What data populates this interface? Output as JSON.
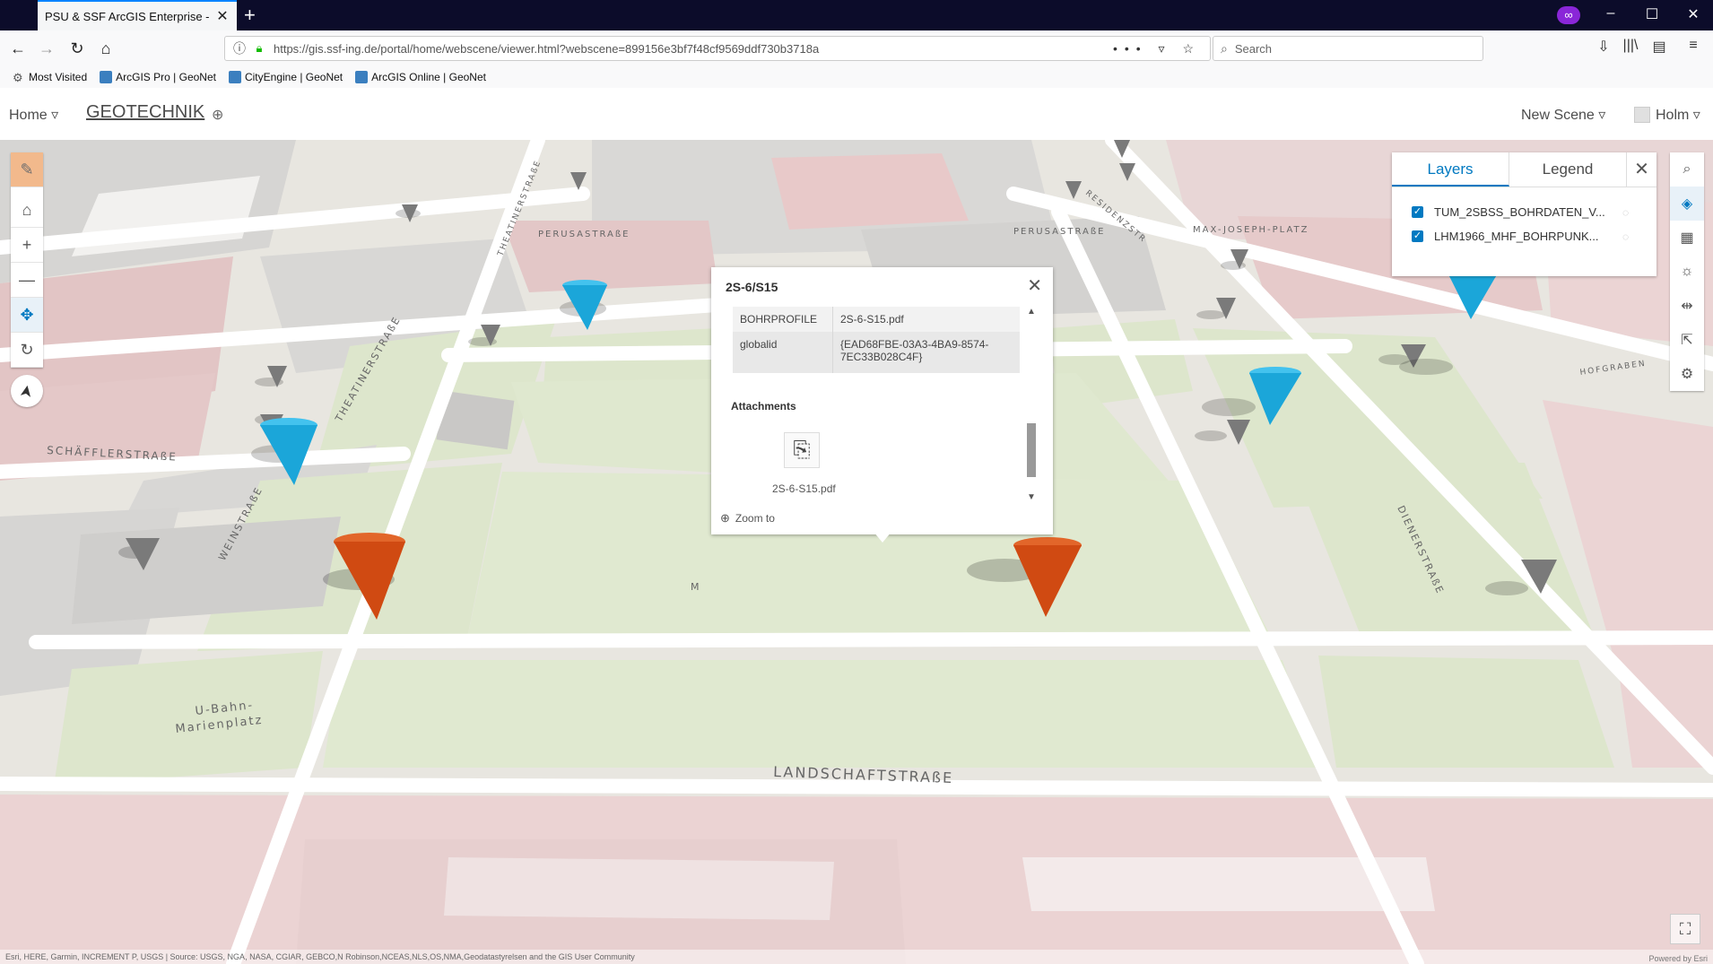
{
  "browser": {
    "tab_title": "PSU & SSF ArcGIS Enterprise - GEOTECHNIK",
    "tab_close": "✕",
    "new_tab": "+",
    "private_icon": "∞",
    "window_min": "–",
    "window_max": "☐",
    "window_close": "✕",
    "back": "←",
    "forward": "→",
    "reload": "↻",
    "home": "⌂",
    "url": "https://gis.ssf-ing.de/portal/home/webscene/viewer.html?webscene=899156e3bf7f48cf9569ddf730b3718a",
    "url_actions": "••• ▿ ☆",
    "search_placeholder": "Search",
    "toolbar_icons": [
      "⇩",
      "|||\\",
      "▤",
      "≡"
    ],
    "bookmarks": [
      {
        "label": "Most Visited",
        "icon": "gear-icon"
      },
      {
        "label": "ArcGIS Pro | GeoNet",
        "icon": "globe-icon"
      },
      {
        "label": "CityEngine | GeoNet",
        "icon": "globe-icon"
      },
      {
        "label": "ArcGIS Online | GeoNet",
        "icon": "globe-icon"
      }
    ]
  },
  "header": {
    "home_label": "Home ▿",
    "title": "GEOTECHNIK",
    "globe": "⊕",
    "new_scene": "New Scene ▿",
    "user": "Holm ▿"
  },
  "left_tools": [
    {
      "name": "edit-tool",
      "icon": "✎"
    },
    {
      "name": "home-tool",
      "icon": "⌂"
    },
    {
      "name": "zoom-in-tool",
      "icon": "+"
    },
    {
      "name": "zoom-out-tool",
      "icon": "—"
    },
    {
      "name": "pan-tool",
      "icon": "✥"
    },
    {
      "name": "rotate-tool",
      "icon": "↻"
    }
  ],
  "compass": "➤",
  "right_tools": [
    {
      "name": "search-tool",
      "icon": "⌕"
    },
    {
      "name": "layers-tool",
      "icon": "◈"
    },
    {
      "name": "basemap-tool",
      "icon": "▦"
    },
    {
      "name": "daylight-tool",
      "icon": "☼"
    },
    {
      "name": "measure-tool",
      "icon": "⇹"
    },
    {
      "name": "share-tool",
      "icon": "⇱"
    },
    {
      "name": "settings-tool",
      "icon": "⚙"
    }
  ],
  "layers_panel": {
    "tabs": [
      "Layers",
      "Legend"
    ],
    "close": "✕",
    "layers": [
      {
        "name": "TUM_2SBSS_BOHRDATEN_V...",
        "check": "✓",
        "eye": "◌"
      },
      {
        "name": "LHM1966_MHF_BOHRPUNK...",
        "check": "✓",
        "eye": "◌"
      }
    ]
  },
  "popup": {
    "title": "2S-6/S15",
    "close": "✕",
    "fields": [
      {
        "name": "BOHRPROFILE",
        "value": "2S-6-S15.pdf"
      },
      {
        "name": "globalid",
        "value": "{EAD68FBE-03A3-4BA9-8574-7EC33B028C4F}"
      }
    ],
    "attachments_label": "Attachments",
    "attachment_icon": "⎘",
    "attachment_name": "2S-6-S15.pdf",
    "zoom_icon": "⊕",
    "zoom_to": "Zoom to",
    "scroll_up": "▲",
    "scroll_down": "▼"
  },
  "map": {
    "streets": [
      "PERUSASTRAßE",
      "PERUSASTRAßE",
      "MAX-JOSEPH-PLATZ",
      "RESIDENZSTR",
      "THEATINERSTRAßE",
      "THEATINERSTRAßE",
      "SCHÄFFLERSTRAßE",
      "WEINSTRAßE",
      "DIENERSTRAßE",
      "HOFGRABEN",
      "LANDSCHAFTSTRAßE",
      "U-Bahn-",
      "Marienplatz",
      "M"
    ],
    "colors": {
      "grey_marker": "#7a7a7a",
      "blue_marker": "#1ba6d9",
      "red_marker": "#d04a12",
      "selected_marker": "#a0602b",
      "highlight": "#00ffff"
    }
  },
  "attribution": "Esri, HERE, Garmin, INCREMENT P, USGS | Source: USGS, NGA, NASA, CGIAR, GEBCO,N Robinson,NCEAS,NLS,OS,NMA,Geodatastyrelsen and the GIS User Community",
  "powered_by": "Powered by Esri",
  "fullscreen_icon": "⛶"
}
